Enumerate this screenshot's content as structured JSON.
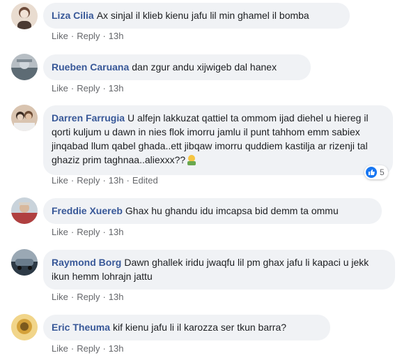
{
  "comments": [
    {
      "author": "Liza Cilia",
      "text": "Ax sinjal il klieb kienu jafu lil min ghamel il bomba",
      "like": "Like",
      "reply": "Reply",
      "time": "13h",
      "colors": [
        "#c8b6a6",
        "#6d4b3a",
        "#f1e2d6"
      ]
    },
    {
      "author": "Rueben Caruana",
      "text": "dan zgur andu xijwigeb dal hanex",
      "like": "Like",
      "reply": "Reply",
      "time": "13h",
      "colors": [
        "#8a8f95",
        "#4c5a66",
        "#cfd6dc"
      ]
    },
    {
      "author": "Darren Farrugia",
      "text": "U alfejn lakkuzat qattiel ta ommom ijad diehel u hiereg il qorti kuljum u dawn in nies flok imorru jamlu il punt tahhom emm sabiex jinqabad llum qabel ghada..ett jibqaw imorru quddiem kastilja ar rizenji tal ghaziz prim taghnaa..aliexxx??",
      "like": "Like",
      "reply": "Reply",
      "time": "13h",
      "edited": "Edited",
      "reaction_count": "5",
      "colors": [
        "#a07a5e",
        "#3a2b22",
        "#e8d3c0"
      ]
    },
    {
      "author": "Freddie Xuereb",
      "text": "Ghax hu ghandu idu imcapsa bid demm ta ommu",
      "like": "Like",
      "reply": "Reply",
      "time": "13h",
      "colors": [
        "#b04040",
        "#d8d1c8",
        "#6b7d8c"
      ]
    },
    {
      "author": "Raymond Borg",
      "text": "Dawn ghallek iridu jwaqfu lil pm ghax jafu li kapaci u jekk ikun hemm lohrajn jattu",
      "like": "Like",
      "reply": "Reply",
      "time": "13h",
      "colors": [
        "#2d3a46",
        "#6a7c8c",
        "#9aa8b4"
      ]
    },
    {
      "author": "Eric Theuma",
      "text": "kif kienu jafu li il karozza ser tkun barra?",
      "like": "Like",
      "reply": "Reply",
      "time": "13h",
      "colors": [
        "#d4a13a",
        "#7c5a1e",
        "#f1d58a"
      ]
    }
  ],
  "colors": {
    "author": "#385898",
    "meta": "#65676b",
    "bubble": "#f0f2f5",
    "like_blue": "#1877f2"
  }
}
